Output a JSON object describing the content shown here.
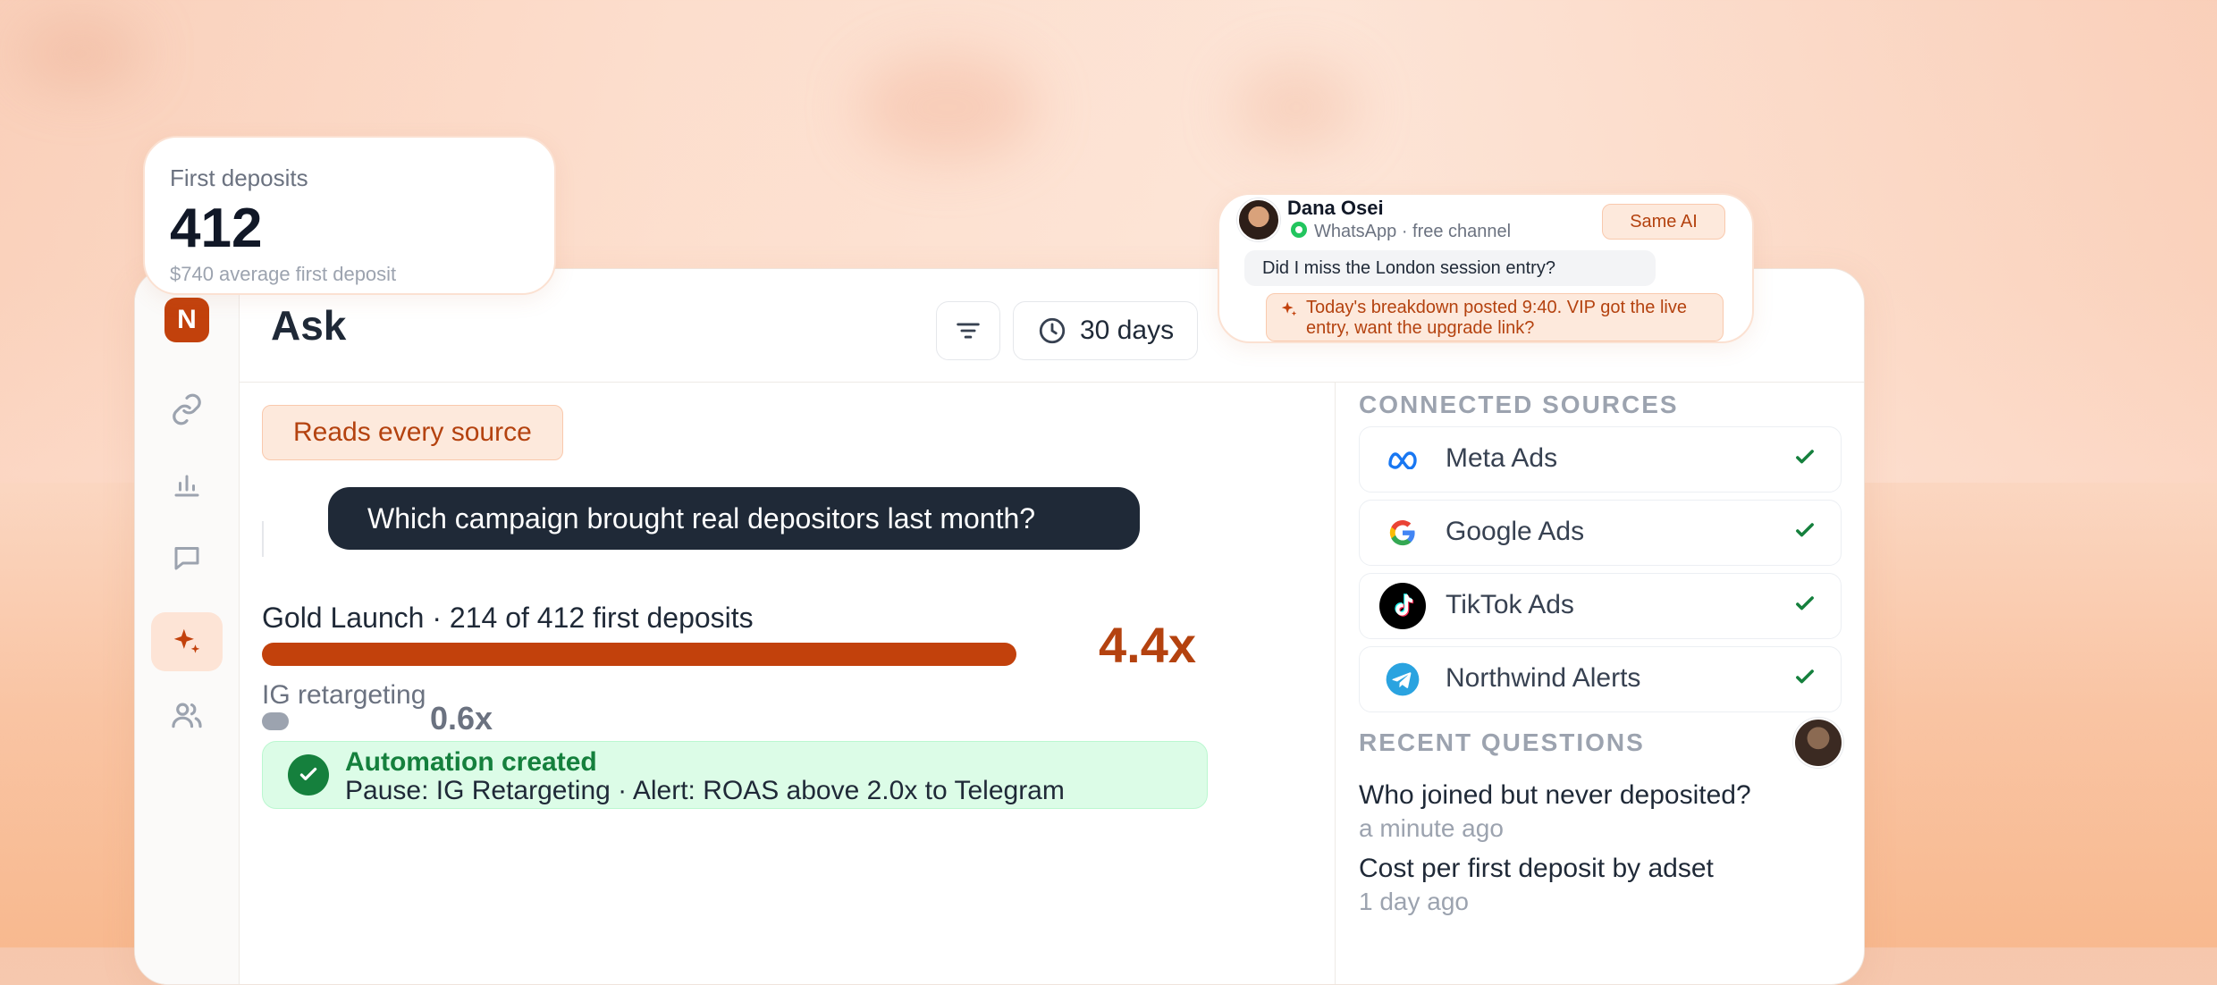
{
  "app": {
    "logo_letter": "N",
    "page_title": "Ask",
    "range_label": "30 days"
  },
  "sidebar": {
    "items": [
      {
        "icon": "link-icon"
      },
      {
        "icon": "bar-chart-icon"
      },
      {
        "icon": "chat-icon"
      },
      {
        "icon": "sparkle-icon",
        "active": true
      },
      {
        "icon": "users-icon"
      }
    ]
  },
  "deposit_card": {
    "label": "First deposits",
    "value": "412",
    "sub": "$740 average first deposit"
  },
  "chat_card": {
    "name": "Dana Osei",
    "channel": "WhatsApp · free channel",
    "badge": "Same AI",
    "message": "Did I miss the London session entry?",
    "reply": "Today's breakdown posted 9:40. VIP got the live entry, want the upgrade link?"
  },
  "main": {
    "pill": "Reads every source",
    "question": "Which campaign brought real depositors last month?",
    "result": {
      "title": "Gold Launch · 214 of 412 first deposits",
      "multiplier": "4.4x",
      "bar_fraction": 1.0
    },
    "secondary": {
      "label": "IG retargeting",
      "multiplier": "0.6x",
      "bar_fraction": 0.19
    },
    "automation": {
      "title": "Automation created",
      "description": "Pause: IG Retargeting · Alert: ROAS above 2.0x to Telegram"
    }
  },
  "sources": {
    "heading": "CONNECTED SOURCES",
    "items": [
      {
        "name": "Meta Ads",
        "icon": "meta-icon",
        "connected": true
      },
      {
        "name": "Google Ads",
        "icon": "google-icon",
        "connected": true
      },
      {
        "name": "TikTok Ads",
        "icon": "tiktok-icon",
        "connected": true
      },
      {
        "name": "Northwind Alerts",
        "icon": "telegram-icon",
        "connected": true
      }
    ]
  },
  "recent": {
    "heading": "RECENT QUESTIONS",
    "items": [
      {
        "question": "Who joined but never deposited?",
        "time": "a minute ago"
      },
      {
        "question": "Cost per first deposit by adset",
        "time": "1 day ago"
      }
    ]
  },
  "colors": {
    "accent": "#c2410c",
    "dark": "#1f2937",
    "success": "#15803d"
  }
}
